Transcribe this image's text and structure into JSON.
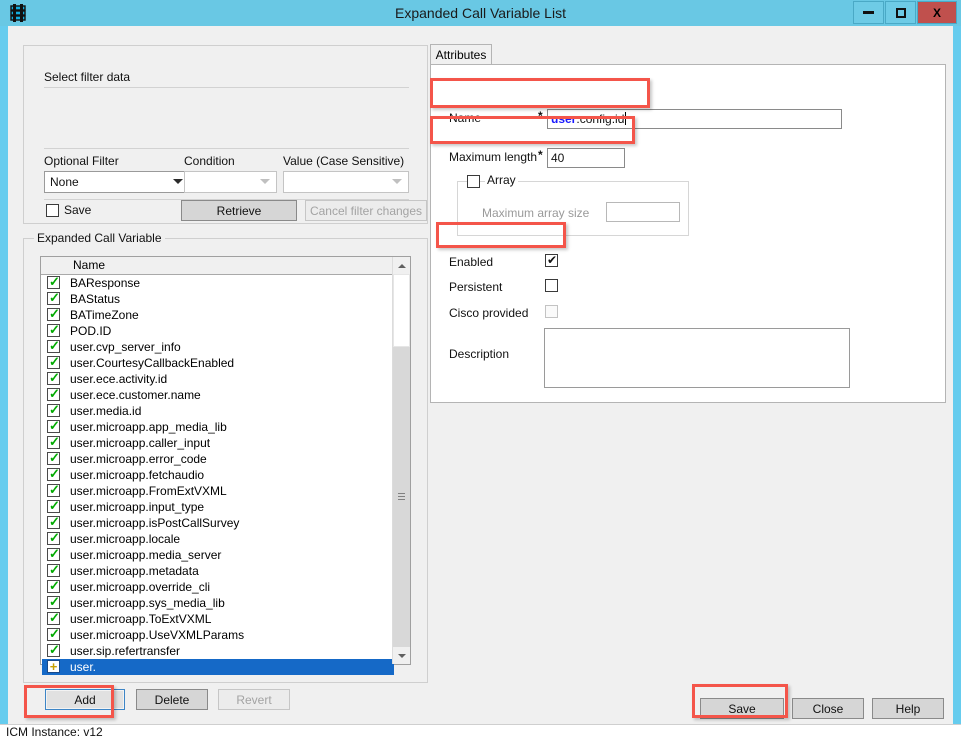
{
  "window": {
    "title": "Expanded Call Variable List",
    "app_icon": "stacked-layers-icon",
    "minimize_label": "",
    "maximize_label": "",
    "close_label": "X"
  },
  "filter": {
    "group_label": "Select filter data",
    "optional_filter_label": "Optional Filter",
    "optional_filter_value": "None",
    "condition_label": "Condition",
    "condition_value": "",
    "value_label": "Value (Case Sensitive)",
    "value_value": "",
    "save_checkbox_label": "Save",
    "retrieve_button": "Retrieve",
    "cancel_button": "Cancel filter changes"
  },
  "list": {
    "group_label": "Expanded Call Variable",
    "column_header": "Name",
    "rows": [
      {
        "label": "BAResponse",
        "icon": "checked-box-icon",
        "selected": false
      },
      {
        "label": "BAStatus",
        "icon": "checked-box-icon",
        "selected": false
      },
      {
        "label": "BATimeZone",
        "icon": "checked-box-icon",
        "selected": false
      },
      {
        "label": "POD.ID",
        "icon": "checked-box-icon",
        "selected": false
      },
      {
        "label": "user.cvp_server_info",
        "icon": "checked-box-icon",
        "selected": false
      },
      {
        "label": "user.CourtesyCallbackEnabled",
        "icon": "checked-box-icon",
        "selected": false
      },
      {
        "label": "user.ece.activity.id",
        "icon": "checked-box-icon",
        "selected": false
      },
      {
        "label": "user.ece.customer.name",
        "icon": "checked-box-icon",
        "selected": false
      },
      {
        "label": "user.media.id",
        "icon": "checked-box-icon",
        "selected": false
      },
      {
        "label": "user.microapp.app_media_lib",
        "icon": "checked-box-icon",
        "selected": false
      },
      {
        "label": "user.microapp.caller_input",
        "icon": "checked-box-icon",
        "selected": false
      },
      {
        "label": "user.microapp.error_code",
        "icon": "checked-box-icon",
        "selected": false
      },
      {
        "label": "user.microapp.fetchaudio",
        "icon": "checked-box-icon",
        "selected": false
      },
      {
        "label": "user.microapp.FromExtVXML",
        "icon": "checked-box-icon",
        "selected": false
      },
      {
        "label": "user.microapp.input_type",
        "icon": "checked-box-icon",
        "selected": false
      },
      {
        "label": "user.microapp.isPostCallSurvey",
        "icon": "checked-box-icon",
        "selected": false
      },
      {
        "label": "user.microapp.locale",
        "icon": "checked-box-icon",
        "selected": false
      },
      {
        "label": "user.microapp.media_server",
        "icon": "checked-box-icon",
        "selected": false
      },
      {
        "label": "user.microapp.metadata",
        "icon": "checked-box-icon",
        "selected": false
      },
      {
        "label": "user.microapp.override_cli",
        "icon": "checked-box-icon",
        "selected": false
      },
      {
        "label": "user.microapp.sys_media_lib",
        "icon": "checked-box-icon",
        "selected": false
      },
      {
        "label": "user.microapp.ToExtVXML",
        "icon": "checked-box-icon",
        "selected": false
      },
      {
        "label": "user.microapp.UseVXMLParams",
        "icon": "checked-box-icon",
        "selected": false
      },
      {
        "label": "user.sip.refertransfer",
        "icon": "checked-box-icon",
        "selected": false
      },
      {
        "label": "user.",
        "icon": "plus-box-icon",
        "selected": true
      }
    ],
    "scrollbar": {
      "up_icon": "chevron-up-icon",
      "down_icon": "chevron-down-icon"
    }
  },
  "list_buttons": {
    "add": "Add",
    "delete": "Delete",
    "revert": "Revert"
  },
  "attributes": {
    "tab_label": "Attributes",
    "name_label": "Name",
    "name_required": "*",
    "name_value_selected": "user",
    "name_value_rest": ".config.id",
    "max_length_label": "Maximum length",
    "max_length_required": "*",
    "max_length_value": "40",
    "array_label": "Array",
    "array_checked": false,
    "max_array_size_label": "Maximum array size",
    "max_array_size_value": "",
    "enabled_label": "Enabled",
    "enabled_checked": true,
    "persistent_label": "Persistent",
    "persistent_checked": false,
    "cisco_provided_label": "Cisco provided",
    "cisco_provided_checked": false,
    "description_label": "Description",
    "description_value": ""
  },
  "dialog_buttons": {
    "save": "Save",
    "close": "Close",
    "help": "Help"
  },
  "statusbar": {
    "text": "ICM Instance: v12"
  },
  "colors": {
    "titlebar": "#66ccee",
    "close_button": "#c0504d",
    "selection": "#1569c7",
    "annotation": "#f4554a",
    "client_bg": "#f0f0f0"
  }
}
